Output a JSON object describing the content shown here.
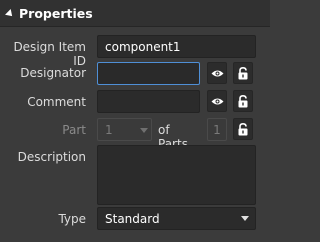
{
  "header": {
    "title": "Properties"
  },
  "fields": {
    "design_item_id": {
      "label": "Design Item ID",
      "value": "component1"
    },
    "designator": {
      "label": "Designator",
      "value": ""
    },
    "comment": {
      "label": "Comment",
      "value": ""
    },
    "part": {
      "label": "Part",
      "value": "1"
    },
    "of_parts": {
      "label": "of Parts",
      "value": "1"
    },
    "description": {
      "label": "Description",
      "value": ""
    },
    "type": {
      "label": "Type",
      "value": "Standard"
    }
  },
  "icons": {
    "visibility": "eye-icon",
    "lock": "lock-icon"
  },
  "colors": {
    "background": "#3b3b3b",
    "field": "#2b2b2b",
    "focus": "#4f8fd6"
  }
}
